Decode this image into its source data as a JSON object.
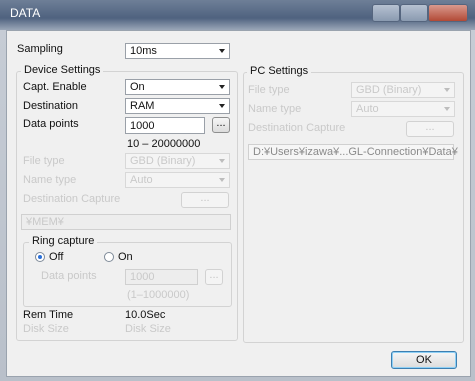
{
  "window": {
    "title": "DATA"
  },
  "sampling": {
    "label": "Sampling",
    "value": "10ms"
  },
  "device": {
    "title": "Device Settings",
    "capt_enable_label": "Capt. Enable",
    "capt_enable_value": "On",
    "destination_label": "Destination",
    "destination_value": "RAM",
    "data_points_label": "Data points",
    "data_points_value": "1000",
    "data_points_range": "10 – 20000000",
    "browse_label": "...",
    "file_type_label": "File type",
    "file_type_value": "GBD (Binary)",
    "name_type_label": "Name type",
    "name_type_value": "Auto",
    "dest_capture_label": "Destination Capture",
    "dest_capture_button": "...",
    "path_value": "¥MEM¥"
  },
  "ring": {
    "title": "Ring capture",
    "off_label": "Off",
    "on_label": "On",
    "data_points_label": "Data points",
    "data_points_value": "1000",
    "browse_label": "...",
    "range": "(1–1000000)"
  },
  "rem_time": {
    "label": "Rem Time",
    "value": "10.0Sec"
  },
  "disk_size": {
    "label": "Disk Size",
    "value": "Disk Size"
  },
  "pc": {
    "title": "PC Settings",
    "file_type_label": "File type",
    "file_type_value": "GBD (Binary)",
    "name_type_label": "Name type",
    "name_type_value": "Auto",
    "dest_capture_label": "Destination Capture",
    "dest_capture_button": "...",
    "path_value": "D:¥Users¥izawa¥...GL-Connection¥Data¥"
  },
  "ok_label": "OK"
}
